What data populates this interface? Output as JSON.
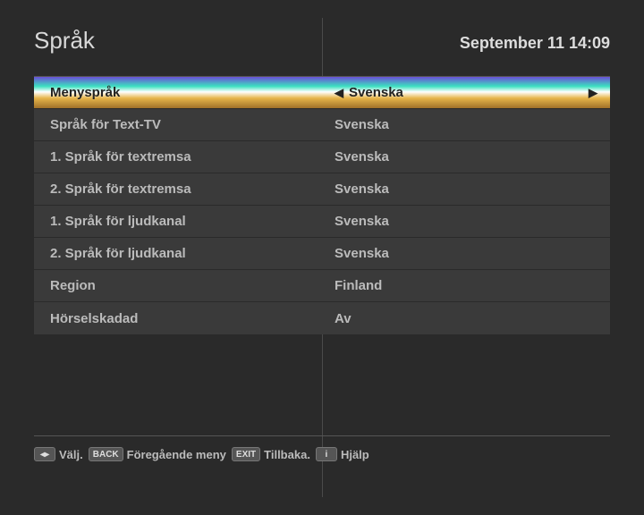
{
  "header": {
    "title": "Språk",
    "datetime": "September 11 14:09"
  },
  "rows": [
    {
      "label": "Menyspråk",
      "value": "Svenska",
      "selected": true,
      "arrows": true
    },
    {
      "label": "Språk för Text-TV",
      "value": "Svenska",
      "selected": false,
      "arrows": false
    },
    {
      "label": "1. Språk för textremsa",
      "value": "Svenska",
      "selected": false,
      "arrows": false
    },
    {
      "label": "2. Språk för textremsa",
      "value": "Svenska",
      "selected": false,
      "arrows": false
    },
    {
      "label": "1. Språk för ljudkanal",
      "value": "Svenska",
      "selected": false,
      "arrows": false
    },
    {
      "label": "2. Språk för ljudkanal",
      "value": "Svenska",
      "selected": false,
      "arrows": false
    },
    {
      "label": "Region",
      "value": "Finland",
      "selected": false,
      "arrows": false
    },
    {
      "label": "Hörselskadad",
      "value": "Av",
      "selected": false,
      "arrows": false
    }
  ],
  "footer": {
    "hints": [
      {
        "key": "◂▸",
        "label": "Välj."
      },
      {
        "key": "BACK",
        "label": "Föregående meny"
      },
      {
        "key": "EXIT",
        "label": "Tillbaka."
      },
      {
        "key": "i",
        "label": "Hjälp"
      }
    ]
  }
}
